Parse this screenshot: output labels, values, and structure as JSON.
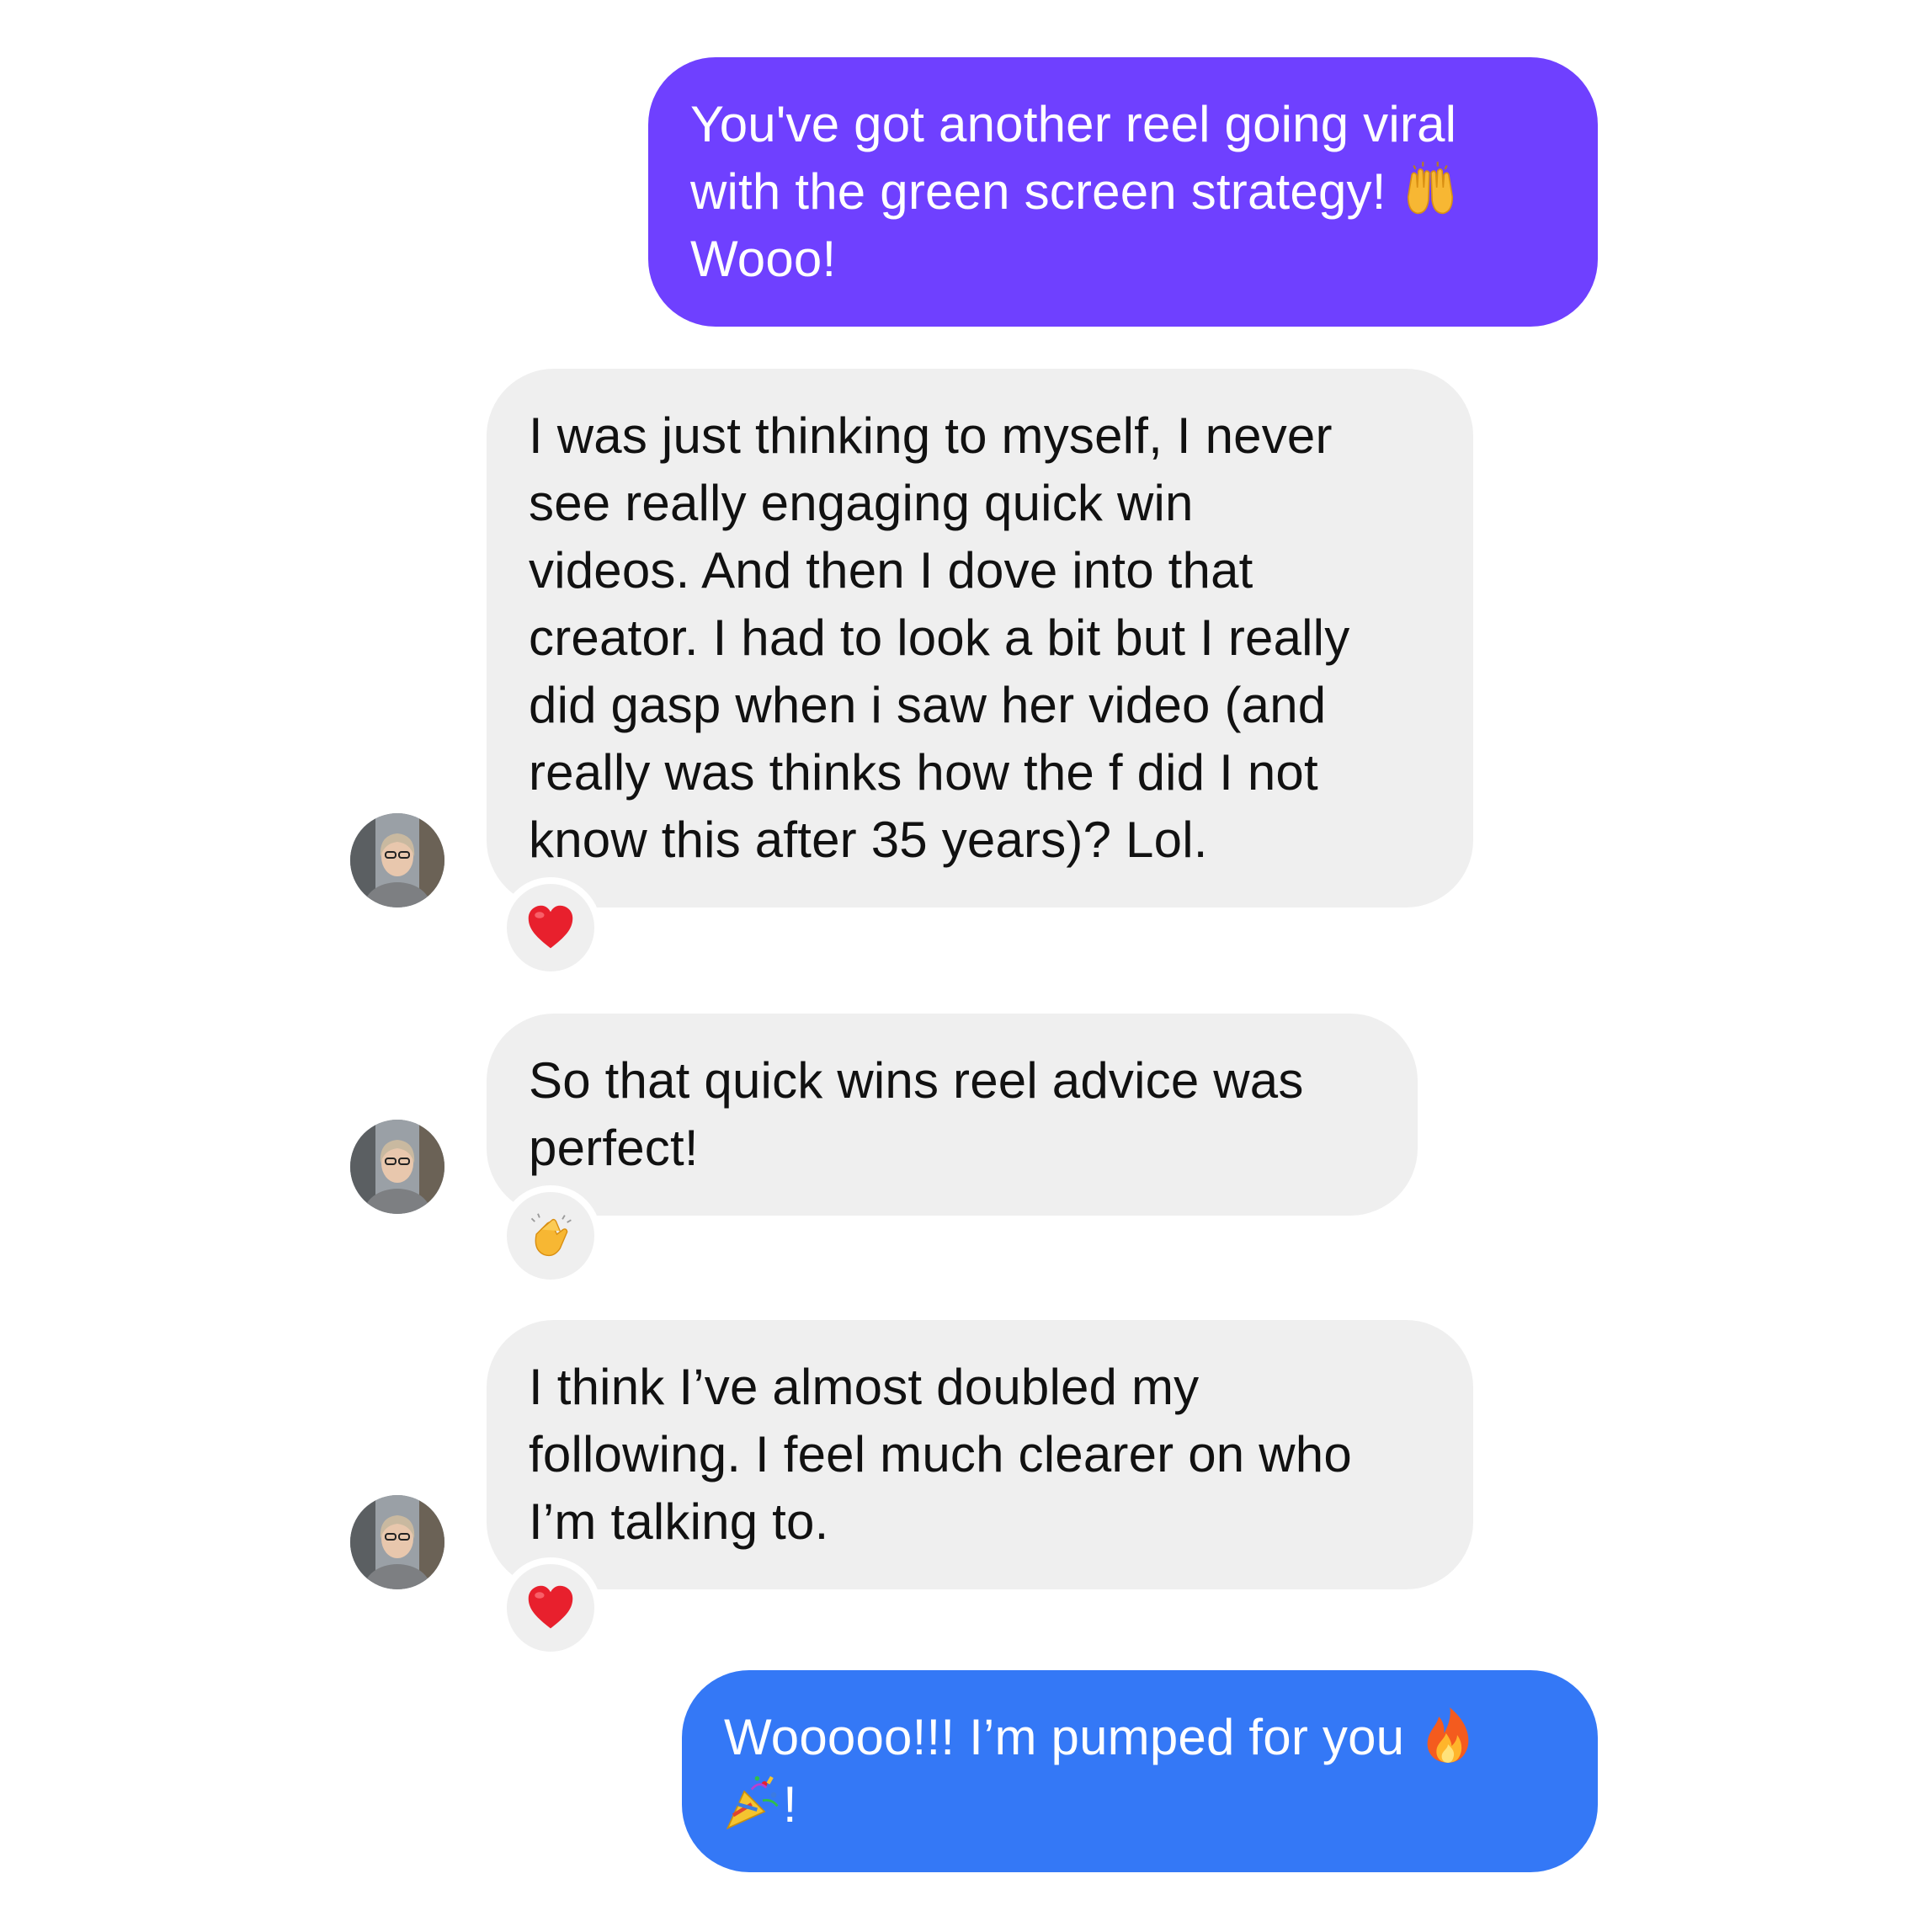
{
  "messages": [
    {
      "id": "m1",
      "direction": "sent",
      "color": "#6f40ff",
      "lines": [
        "You've got another reel going viral",
        "with the green screen strategy!",
        "Wooo!"
      ],
      "emoji": "raising-hands-icon"
    },
    {
      "id": "m2",
      "direction": "received",
      "lines": [
        "I was just thinking to myself, I never",
        "see really engaging quick win",
        "videos. And then I dove into that",
        "creator. I had to look a bit but I really",
        "did gasp when i saw her video (and",
        "really was thinks how the f did I not",
        "know this after 35 years)?  Lol."
      ],
      "reaction": "heart-icon"
    },
    {
      "id": "m3",
      "direction": "received",
      "lines": [
        "So that quick wins reel advice was",
        "perfect!"
      ],
      "reaction": "clapping-hands-icon"
    },
    {
      "id": "m4",
      "direction": "received",
      "lines": [
        "I think I’ve almost doubled my",
        "following. I feel much clearer on who",
        "I’m talking to."
      ],
      "reaction": "heart-icon"
    },
    {
      "id": "m5",
      "direction": "sent",
      "color": "#3478f6",
      "lines": [
        "Wooooo!!! I’m pumped for you",
        "!"
      ],
      "emoji": [
        "fire-icon",
        "party-popper-icon"
      ]
    }
  ],
  "colors": {
    "sent_purple": "#6f40ff",
    "sent_blue": "#3478f6",
    "received_bg": "#efefef",
    "received_text": "#111111"
  }
}
